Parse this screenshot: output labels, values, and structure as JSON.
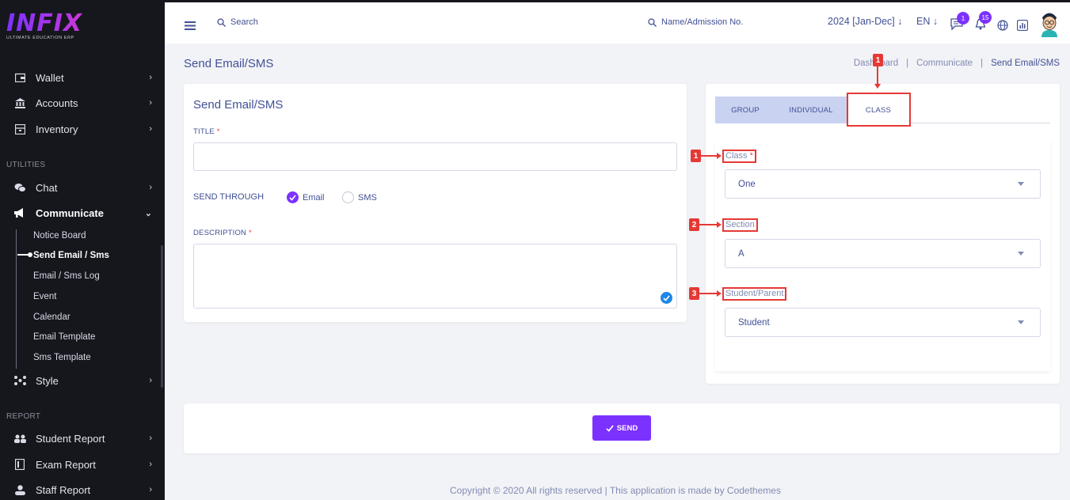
{
  "brand": {
    "logo_text": "INFIX",
    "tagline": "ULTIMATE EDUCATION ERP"
  },
  "sidebar": {
    "items": [
      {
        "label": "Wallet",
        "icon": "wallet-icon"
      },
      {
        "label": "Accounts",
        "icon": "bank-icon"
      },
      {
        "label": "Inventory",
        "icon": "inventory-icon"
      }
    ],
    "section_utilities": "UTILITIES",
    "chat_label": "Chat",
    "communicate_label": "Communicate",
    "communicate_sub": [
      "Notice Board",
      "Send Email / Sms",
      "Email / Sms Log",
      "Event",
      "Calendar",
      "Email Template",
      "Sms Template"
    ],
    "style_label": "Style",
    "section_report": "REPORT",
    "reports": [
      "Student Report",
      "Exam Report",
      "Staff Report"
    ]
  },
  "header": {
    "search_placeholder": "Search",
    "search2_placeholder": "Name/Admission No.",
    "session": "2024 [Jan-Dec]",
    "language": "EN",
    "chat_badge": "1",
    "notification_badge": "15"
  },
  "page": {
    "title": "Send Email/SMS",
    "breadcrumb": [
      "Dashboard",
      "Communicate",
      "Send Email/SMS"
    ]
  },
  "form": {
    "title": "Send Email/SMS",
    "title_label": "TITLE",
    "send_through_label": "SEND THROUGH",
    "options": [
      "Email",
      "SMS"
    ],
    "selected_option": "Email",
    "description_label": "DESCRIPTION",
    "required_mark": "*"
  },
  "tabs": [
    "GROUP",
    "INDIVIDUAL",
    "CLASS"
  ],
  "active_tab": "CLASS",
  "class_tab": {
    "class_label": "Class",
    "class_value": "One",
    "section_label": "Section",
    "section_value": "A",
    "student_parent_label": "Student/Parent",
    "student_parent_value": "Student"
  },
  "annotations": [
    "1",
    "1",
    "2",
    "3"
  ],
  "send_button": "SEND",
  "footer": "Copyright © 2020 All rights reserved | This application is made by Codethemes",
  "colors": {
    "primary": "#7c32ff",
    "sidebar": "#15171d",
    "annotation": "#e53935",
    "text": "#415094"
  }
}
